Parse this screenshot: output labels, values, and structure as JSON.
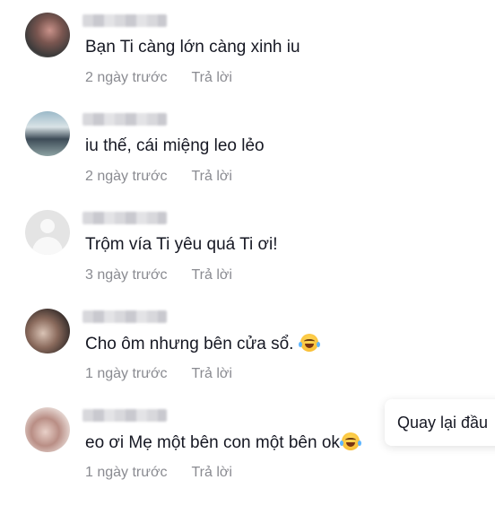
{
  "comments": [
    {
      "text": "Bạn Ti càng lớn càng xinh iu",
      "time": "2 ngày trước",
      "reply": "Trả lời"
    },
    {
      "text": "iu thế, cái miệng leo lẻo",
      "time": "2 ngày trước",
      "reply": "Trả lời"
    },
    {
      "text": "Trộm vía Ti yêu quá Ti ơi!",
      "time": "3 ngày trước",
      "reply": "Trả lời"
    },
    {
      "text": "Cho ôm nhưng bên cửa sổ.",
      "emoji": "laughing-with-tears",
      "time": "1 ngày trước",
      "reply": "Trả lời"
    },
    {
      "text": "eo ơi Mẹ một bên con một bên ok",
      "emoji": "laughing-with-tears",
      "time": "1 ngày trước",
      "reply": "Trả lời"
    }
  ],
  "back_to_top": {
    "label": "Quay lại đầu"
  },
  "colors": {
    "text": "#161823",
    "meta": "#8a8b91"
  }
}
